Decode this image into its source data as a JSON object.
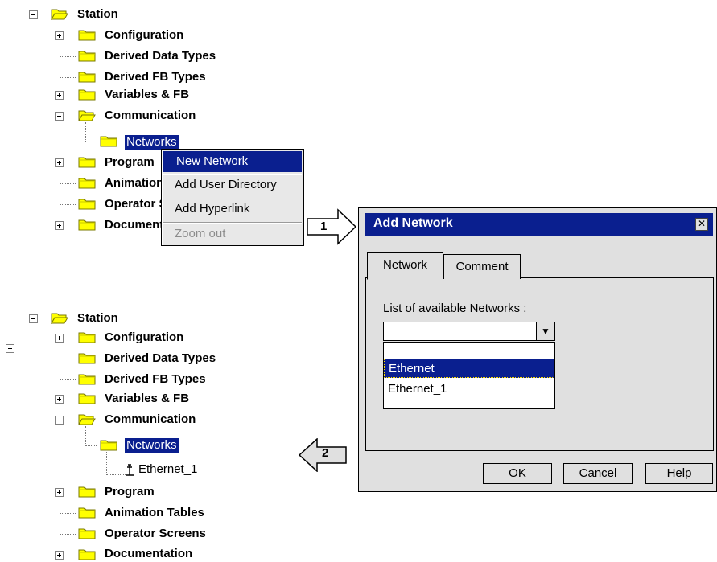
{
  "top_tree": {
    "root": "Station",
    "items": [
      "Configuration",
      "Derived Data Types",
      "Derived FB Types",
      "Variables & FB",
      "Communication"
    ],
    "networks": "Networks",
    "items_after": [
      "Program",
      "Animation Tables",
      "Operator Screens",
      "Documentation"
    ]
  },
  "context_menu": {
    "items": [
      "New Network",
      "Add User Directory",
      "Add Hyperlink",
      "Zoom out"
    ]
  },
  "callout_1": "1",
  "callout_2": "2",
  "dialog": {
    "title": "Add Network",
    "close_glyph": "✕",
    "tabs": [
      "Network",
      "Comment"
    ],
    "list_label": "List of available Networks :",
    "combo_value": "",
    "combo_arrow": "▼",
    "options": [
      "",
      "Ethernet",
      "Ethernet_1"
    ],
    "buttons": [
      "OK",
      "Cancel",
      "Help"
    ]
  },
  "bottom_tree": {
    "root": "Station",
    "items": [
      "Configuration",
      "Derived Data Types",
      "Derived FB Types",
      "Variables & FB",
      "Communication"
    ],
    "networks": "Networks",
    "network_child": "Ethernet_1",
    "items_after": [
      "Program",
      "Animation Tables",
      "Operator Screens",
      "Documentation"
    ]
  },
  "colors": {
    "selection": "#0a1f8f",
    "folder": "#ffff00",
    "dialog_bg": "#e0e0e0"
  },
  "icons": [
    "folder-icon",
    "open-folder-icon",
    "network-node-icon",
    "expand-icon",
    "collapse-icon"
  ]
}
